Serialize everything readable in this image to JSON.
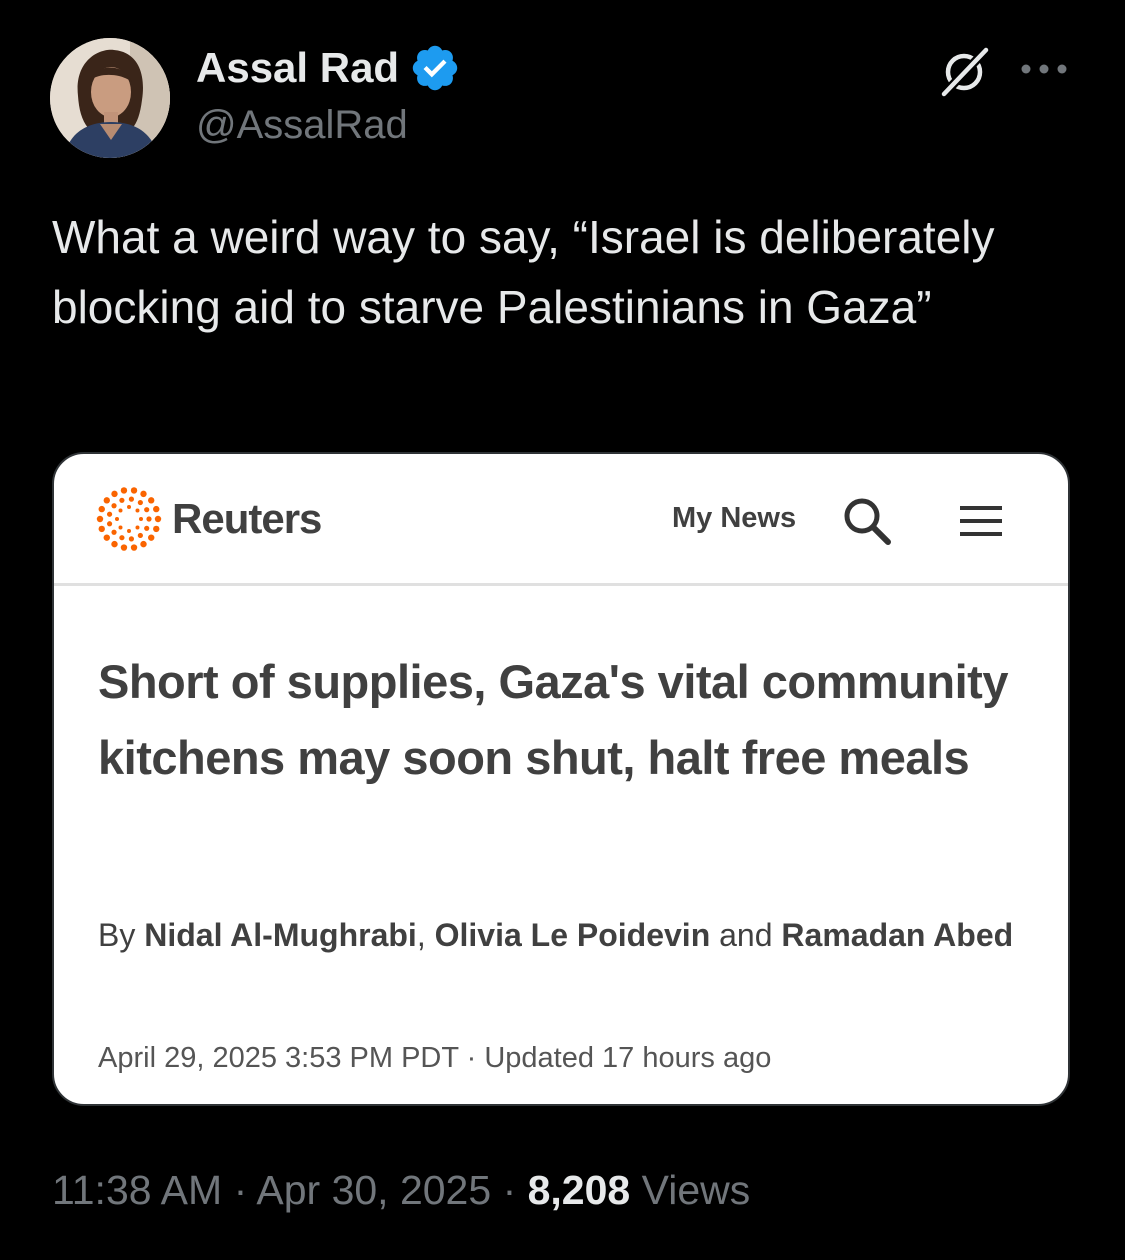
{
  "author": {
    "name": "Assal Rad",
    "handle": "@AssalRad",
    "verified_color": "#1d9bf0"
  },
  "icons": {
    "header_right": [
      "grok-icon",
      "more-options-icon"
    ],
    "card": [
      "reuters-logo-icon",
      "search-icon",
      "menu-icon"
    ]
  },
  "tweet": {
    "text": "What a weird way to say, “Israel is deliberately blocking aid to starve Palestinians in Gaza”"
  },
  "card": {
    "brand": "Reuters",
    "nav_my_news": "My News",
    "headline": "Short of supplies, Gaza's vital community kitchens may soon shut, halt free meals",
    "byline": {
      "prefix": "By",
      "author1": "Nidal Al-Mughrabi",
      "sep1": ",",
      "author2": "Olivia Le Poidevin",
      "conj": "and",
      "author3": "Ramadan Abed"
    },
    "dateline": {
      "published": "April 29, 2025 3:53 PM PDT",
      "sep": " · ",
      "updated": "Updated 17 hours ago"
    },
    "accent_color": "#fa6400"
  },
  "meta": {
    "time": "11:38 AM",
    "sep1": " · ",
    "date": "Apr 30, 2025",
    "sep2": " · ",
    "views_count": "8,208",
    "views_label": " Views"
  }
}
